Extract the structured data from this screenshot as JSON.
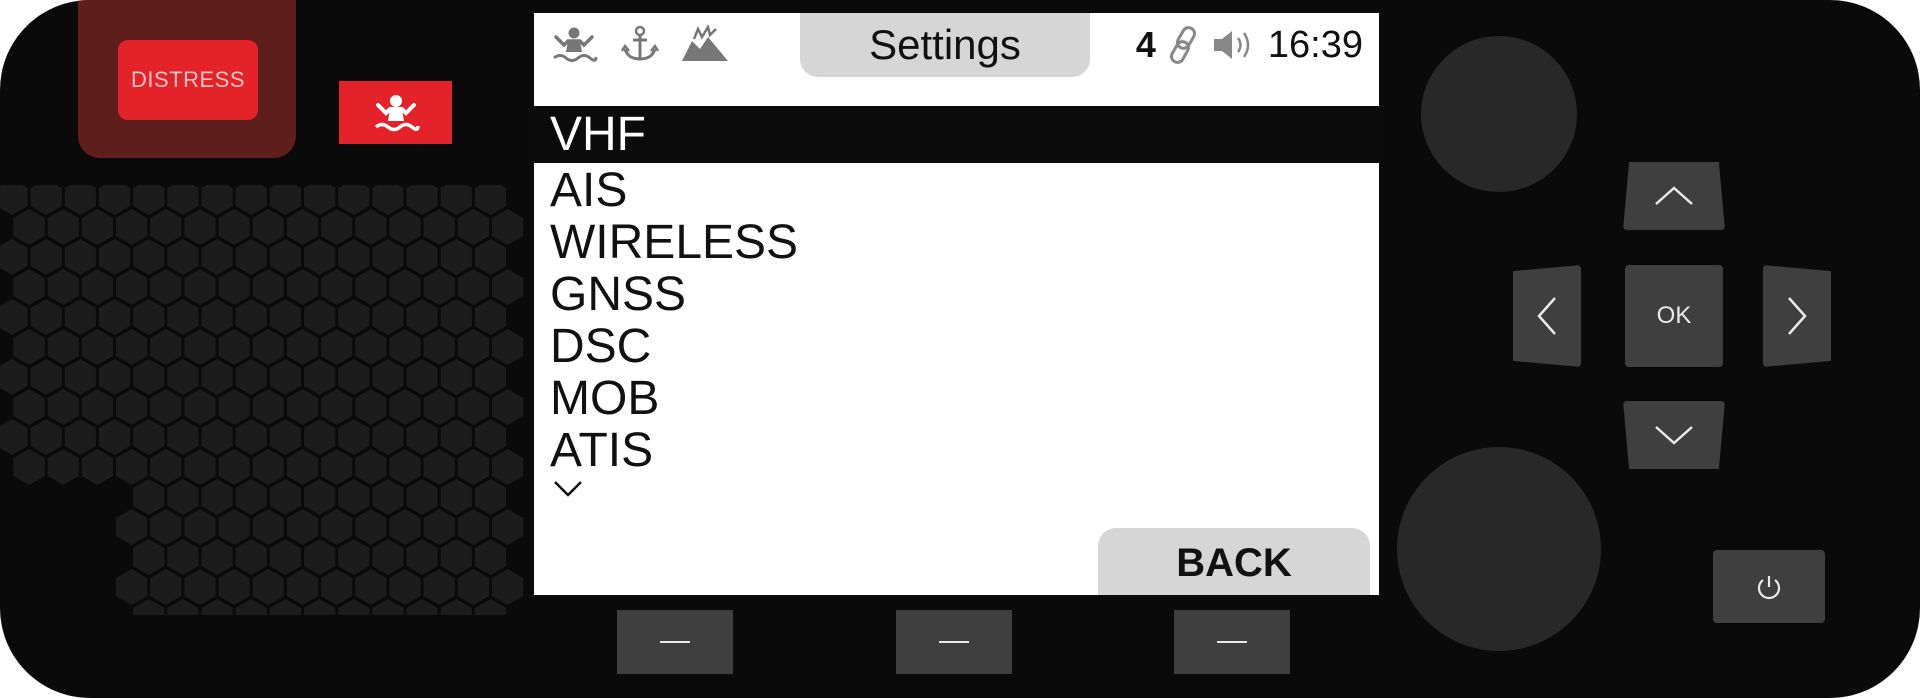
{
  "device": {
    "distress_label": "DISTRESS",
    "colors": {
      "body": "#0a0a0a",
      "accent_red": "#e4222a",
      "housing": "#5e1f1c",
      "key": "#3f3f3f"
    }
  },
  "status_bar": {
    "icons": [
      "mob-person-icon",
      "anchor-icon",
      "aground-icon"
    ],
    "title": "Settings",
    "channel": "4",
    "link_icon": "link-icon",
    "speaker_icon": "speaker-icon",
    "time": "16:39"
  },
  "menu": {
    "items": [
      {
        "label": "VHF",
        "selected": true
      },
      {
        "label": "AIS"
      },
      {
        "label": "WIRELESS"
      },
      {
        "label": "GNSS"
      },
      {
        "label": "DSC"
      },
      {
        "label": "MOB"
      },
      {
        "label": "ATIS"
      }
    ],
    "more_icon": "chevron-down-icon"
  },
  "soft_buttons": {
    "back_label": "BACK"
  },
  "nav": {
    "ok_label": "OK"
  }
}
